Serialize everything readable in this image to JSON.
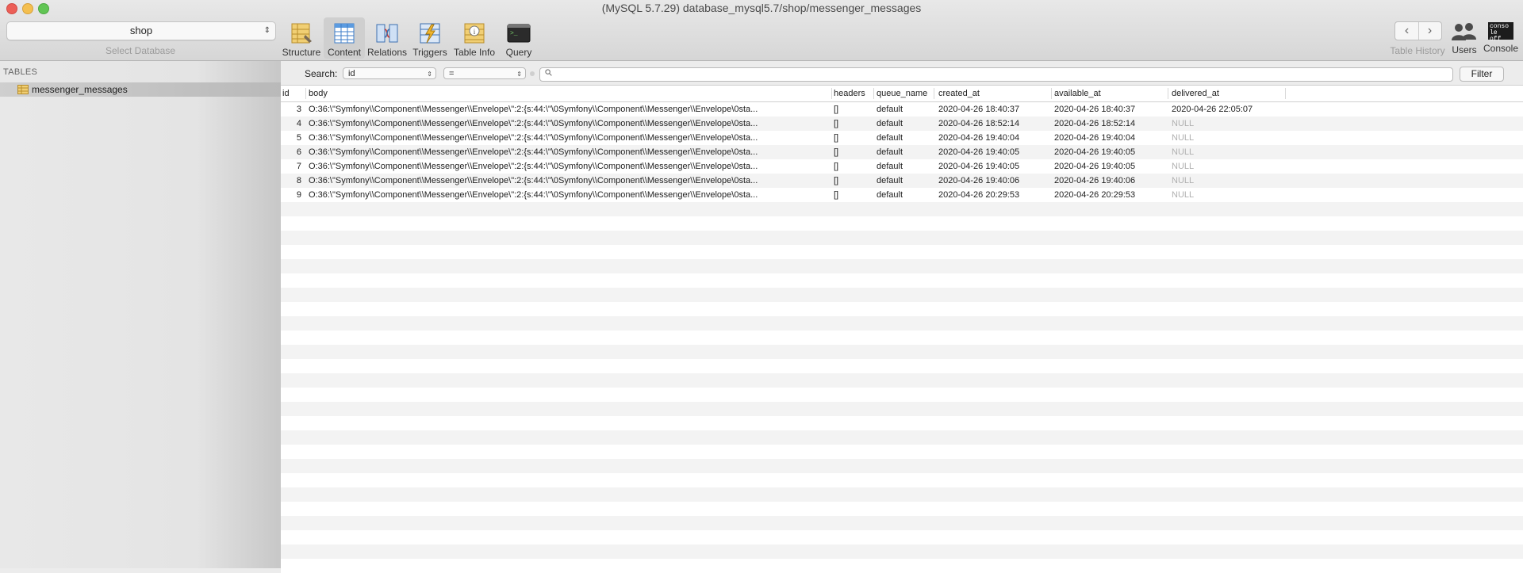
{
  "window": {
    "title": "(MySQL 5.7.29) database_mysql5.7/shop/messenger_messages"
  },
  "database_selector": {
    "value": "shop",
    "label": "Select Database"
  },
  "toolbar": {
    "items": [
      {
        "label": "Structure",
        "icon": "structure-icon"
      },
      {
        "label": "Content",
        "icon": "content-icon"
      },
      {
        "label": "Relations",
        "icon": "relations-icon"
      },
      {
        "label": "Triggers",
        "icon": "triggers-icon"
      },
      {
        "label": "Table Info",
        "icon": "table-info-icon"
      },
      {
        "label": "Query",
        "icon": "query-icon"
      }
    ],
    "right": {
      "history_label": "Table History",
      "users_label": "Users",
      "console_label": "Console",
      "console_icon_text": "conso le off"
    }
  },
  "sidebar": {
    "heading": "TABLES",
    "tables": [
      "messenger_messages"
    ]
  },
  "search": {
    "label": "Search:",
    "field": "id",
    "operator": "=",
    "value": "",
    "filter_button": "Filter"
  },
  "table": {
    "columns": [
      "id",
      "body",
      "headers",
      "queue_name",
      "created_at",
      "available_at",
      "delivered_at"
    ],
    "rows": [
      {
        "id": "3",
        "body": "O:36:\\\"Symfony\\\\Component\\\\Messenger\\\\Envelope\\\":2:{s:44:\\\"\\0Symfony\\\\Component\\\\Messenger\\\\Envelope\\0sta...",
        "headers": "[]",
        "queue_name": "default",
        "created_at": "2020-04-26 18:40:37",
        "available_at": "2020-04-26 18:40:37",
        "delivered_at": "2020-04-26 22:05:07"
      },
      {
        "id": "4",
        "body": "O:36:\\\"Symfony\\\\Component\\\\Messenger\\\\Envelope\\\":2:{s:44:\\\"\\0Symfony\\\\Component\\\\Messenger\\\\Envelope\\0sta...",
        "headers": "[]",
        "queue_name": "default",
        "created_at": "2020-04-26 18:52:14",
        "available_at": "2020-04-26 18:52:14",
        "delivered_at": "NULL"
      },
      {
        "id": "5",
        "body": "O:36:\\\"Symfony\\\\Component\\\\Messenger\\\\Envelope\\\":2:{s:44:\\\"\\0Symfony\\\\Component\\\\Messenger\\\\Envelope\\0sta...",
        "headers": "[]",
        "queue_name": "default",
        "created_at": "2020-04-26 19:40:04",
        "available_at": "2020-04-26 19:40:04",
        "delivered_at": "NULL"
      },
      {
        "id": "6",
        "body": "O:36:\\\"Symfony\\\\Component\\\\Messenger\\\\Envelope\\\":2:{s:44:\\\"\\0Symfony\\\\Component\\\\Messenger\\\\Envelope\\0sta...",
        "headers": "[]",
        "queue_name": "default",
        "created_at": "2020-04-26 19:40:05",
        "available_at": "2020-04-26 19:40:05",
        "delivered_at": "NULL"
      },
      {
        "id": "7",
        "body": "O:36:\\\"Symfony\\\\Component\\\\Messenger\\\\Envelope\\\":2:{s:44:\\\"\\0Symfony\\\\Component\\\\Messenger\\\\Envelope\\0sta...",
        "headers": "[]",
        "queue_name": "default",
        "created_at": "2020-04-26 19:40:05",
        "available_at": "2020-04-26 19:40:05",
        "delivered_at": "NULL"
      },
      {
        "id": "8",
        "body": "O:36:\\\"Symfony\\\\Component\\\\Messenger\\\\Envelope\\\":2:{s:44:\\\"\\0Symfony\\\\Component\\\\Messenger\\\\Envelope\\0sta...",
        "headers": "[]",
        "queue_name": "default",
        "created_at": "2020-04-26 19:40:06",
        "available_at": "2020-04-26 19:40:06",
        "delivered_at": "NULL"
      },
      {
        "id": "9",
        "body": "O:36:\\\"Symfony\\\\Component\\\\Messenger\\\\Envelope\\\":2:{s:44:\\\"\\0Symfony\\\\Component\\\\Messenger\\\\Envelope\\0sta...",
        "headers": "[]",
        "queue_name": "default",
        "created_at": "2020-04-26 20:29:53",
        "available_at": "2020-04-26 20:29:53",
        "delivered_at": "NULL"
      }
    ]
  },
  "colors": {
    "null_text": "#b0b0b0",
    "row_alt": "#f3f3f3"
  }
}
